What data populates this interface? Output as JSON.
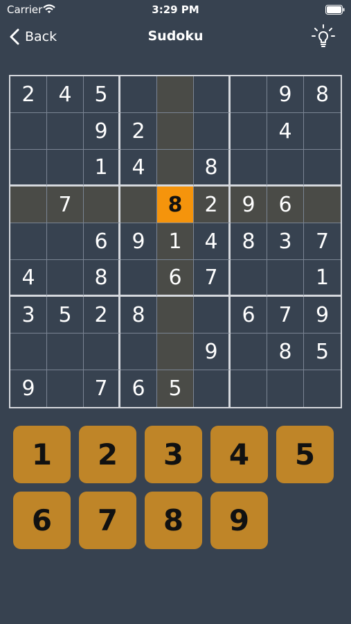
{
  "status_bar": {
    "carrier": "Carrier",
    "time": "3:29 PM"
  },
  "nav": {
    "back_label": "Back",
    "title": "Sudoku",
    "hint_icon": "lightbulb-icon"
  },
  "board": {
    "selected": {
      "row": 4,
      "col": 5
    },
    "cells": [
      [
        "2",
        "4",
        "5",
        "",
        "",
        "",
        "",
        "9",
        "8"
      ],
      [
        "",
        "",
        "9",
        "2",
        "",
        "",
        "",
        "4",
        ""
      ],
      [
        "",
        "",
        "1",
        "4",
        "",
        "8",
        "",
        "",
        ""
      ],
      [
        "",
        "7",
        "",
        "",
        "8",
        "2",
        "9",
        "6",
        ""
      ],
      [
        "",
        "",
        "6",
        "9",
        "1",
        "4",
        "8",
        "3",
        "7"
      ],
      [
        "4",
        "",
        "8",
        "",
        "6",
        "7",
        "",
        "",
        "1"
      ],
      [
        "3",
        "5",
        "2",
        "8",
        "",
        "",
        "6",
        "7",
        "9"
      ],
      [
        "",
        "",
        "",
        "",
        "",
        "9",
        "",
        "8",
        "5"
      ],
      [
        "9",
        "",
        "7",
        "6",
        "5",
        "",
        "",
        "",
        ""
      ]
    ]
  },
  "keypad": {
    "keys": [
      "1",
      "2",
      "3",
      "4",
      "5",
      "6",
      "7",
      "8",
      "9"
    ]
  },
  "colors": {
    "background": "#374250",
    "highlight": "#4a4b47",
    "selected": "#f5940c",
    "key": "#bf8528"
  }
}
